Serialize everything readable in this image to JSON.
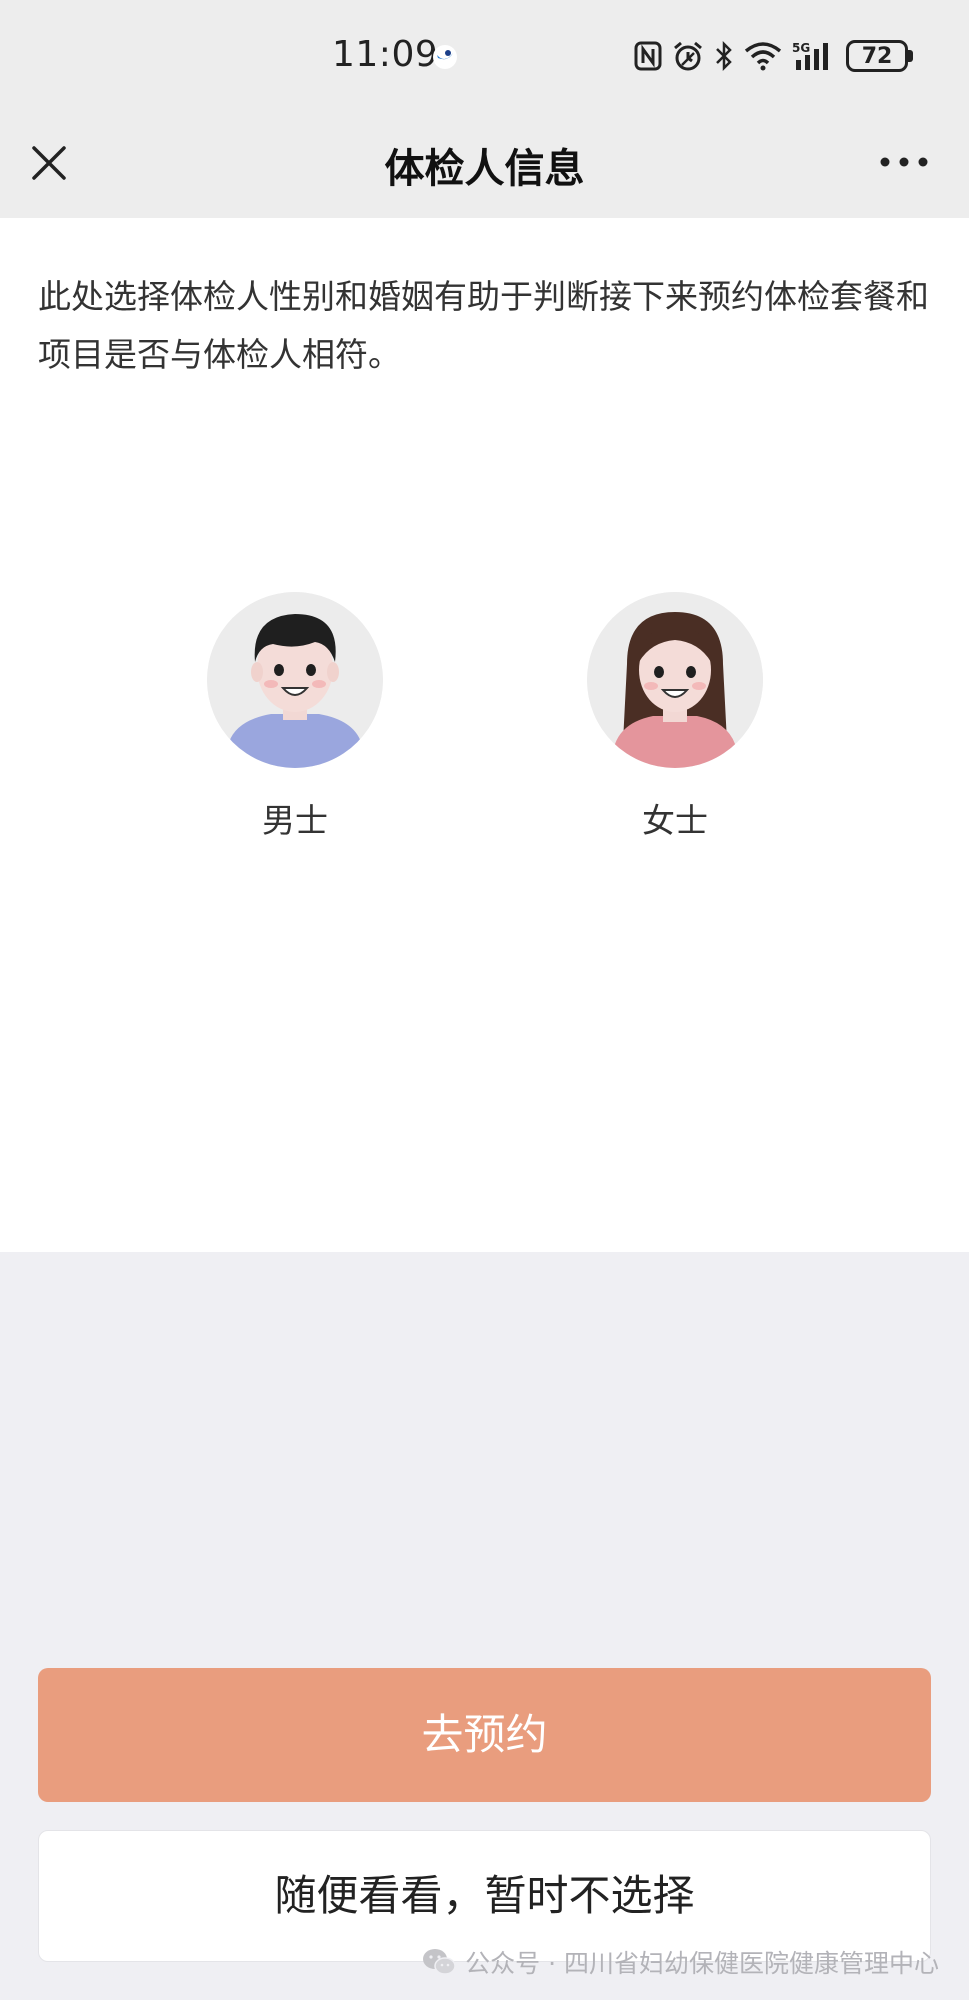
{
  "status_bar": {
    "time": "11:09",
    "battery": "72",
    "network": "5G",
    "icons": [
      "nfc-icon",
      "alarm-icon",
      "bluetooth-icon",
      "wifi-icon",
      "signal-icon",
      "battery-icon"
    ]
  },
  "nav": {
    "title": "体检人信息",
    "close_icon": "close-icon",
    "more_icon": "more-icon"
  },
  "content": {
    "description": "此处选择体检人性别和婚姻有助于判断接下来预约体检套餐和项目是否与体检人相符。",
    "options": [
      {
        "label": "男士",
        "shirt_color": "#9aa6de",
        "hair_color": "#1f1f1f"
      },
      {
        "label": "女士",
        "shirt_color": "#e4959c",
        "hair_color": "#4a2e24"
      }
    ]
  },
  "actions": {
    "primary_label": "去预约",
    "secondary_label": "随便看看，暂时不选择"
  },
  "watermark": {
    "text": "公众号 · 四川省妇幼保健医院健康管理中心"
  },
  "colors": {
    "primary_button": "#e99d7e",
    "header_bg": "#ededed",
    "page_bg": "#efeff3"
  }
}
